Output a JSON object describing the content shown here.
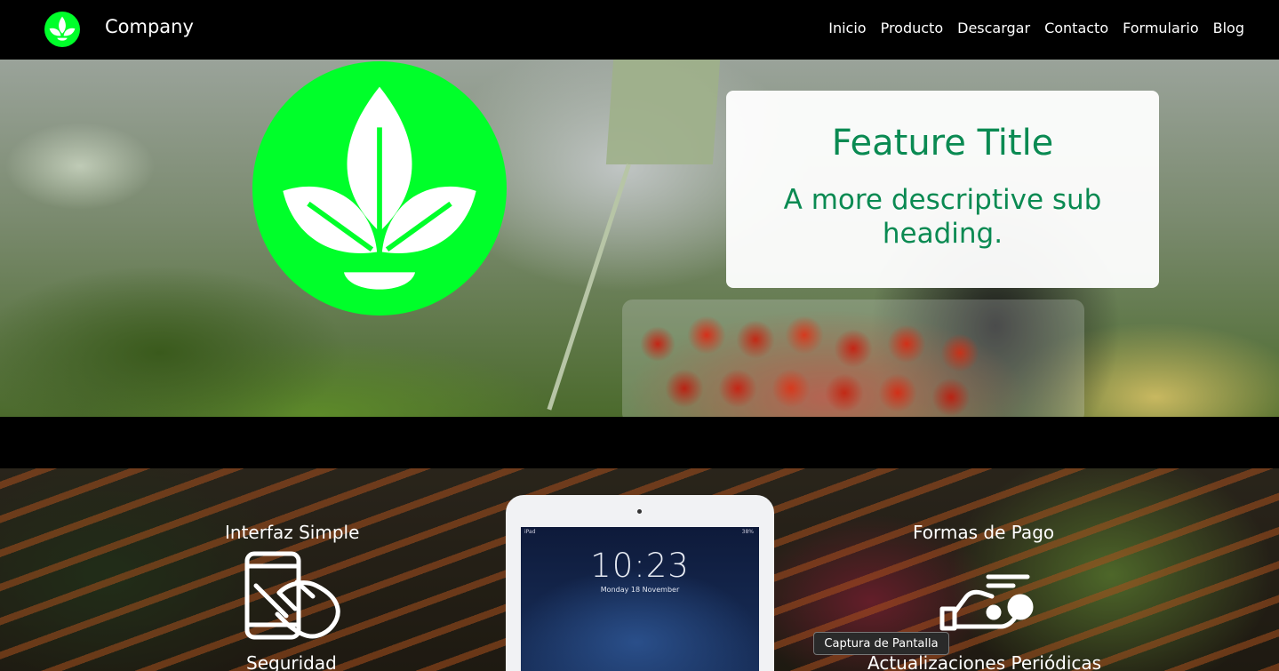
{
  "navbar": {
    "brand_name": "Company",
    "links": [
      "Inicio",
      "Producto",
      "Descargar",
      "Contacto",
      "Formulario",
      "Blog"
    ]
  },
  "hero": {
    "feature_title": "Feature Title",
    "feature_subtitle": "A more descriptive sub heading.",
    "logo_color": "#00ff2a",
    "title_color": "#0a8a52"
  },
  "features": {
    "items": [
      {
        "title": "Interfaz Simple",
        "icon": "touch-phone-icon"
      },
      {
        "title": "Formas de Pago",
        "icon": "payment-hand-icon"
      },
      {
        "title": "Seguridad"
      },
      {
        "title": "Actualizaciones Periódicas"
      }
    ],
    "tablet": {
      "carrier": "iPad",
      "battery": "38% ",
      "time": "10:23",
      "date": "Monday 18 November"
    }
  },
  "tooltip": {
    "text": "Captura de Pantalla"
  }
}
